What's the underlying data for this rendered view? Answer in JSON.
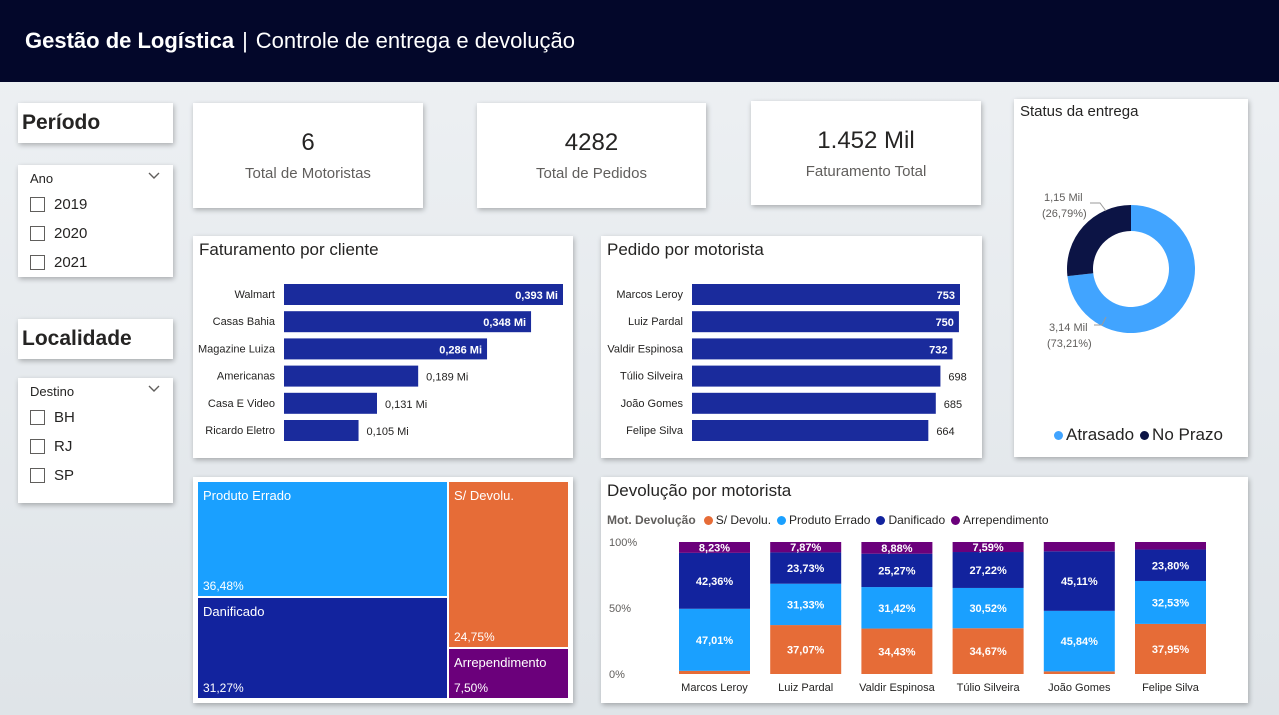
{
  "header": {
    "title_bold": "Gestão de Logística",
    "separator": "|",
    "title_rest": "Controle de entrega e devolução"
  },
  "filters": {
    "periodo": {
      "title": "Período",
      "field": "Ano",
      "options": [
        "2019",
        "2020",
        "2021"
      ]
    },
    "localidade": {
      "title": "Localidade",
      "field": "Destino",
      "options": [
        "BH",
        "RJ",
        "SP"
      ]
    }
  },
  "kpis": [
    {
      "value": "6",
      "label": "Total de Motoristas"
    },
    {
      "value": "4282",
      "label": "Total de Pedidos"
    },
    {
      "value": "1.452 Mil",
      "label": "Faturamento Total"
    }
  ],
  "colors": {
    "navy_bar": "#1a2b9c",
    "light_blue": "#1aa0ff",
    "dark_blue": "#12239e",
    "orange": "#e66c37",
    "purple": "#6b007b",
    "donut_light": "#41a4ff",
    "donut_dark": "#0c1445",
    "header": "#03072a"
  },
  "chart_data": [
    {
      "id": "faturamento",
      "type": "bar",
      "orientation": "horizontal",
      "title": "Faturamento por cliente",
      "categories": [
        "Walmart",
        "Casas Bahia",
        "Magazine Luiza",
        "Americanas",
        "Casa E Video",
        "Ricardo Eletro"
      ],
      "values": [
        0.393,
        0.348,
        0.286,
        0.189,
        0.131,
        0.105
      ],
      "labels": [
        "0,393 Mi",
        "0,348 Mi",
        "0,286 Mi",
        "0,189 Mi",
        "0,131 Mi",
        "0,105 Mi"
      ],
      "unit": "Mi"
    },
    {
      "id": "pedidos",
      "type": "bar",
      "orientation": "horizontal",
      "title": "Pedido por motorista",
      "categories": [
        "Marcos Leroy",
        "Luiz Pardal",
        "Valdir Espinosa",
        "Túlio Silveira",
        "João Gomes",
        "Felipe Silva"
      ],
      "values": [
        753,
        750,
        732,
        698,
        685,
        664
      ],
      "labels": [
        "753",
        "750",
        "732",
        "698",
        "685",
        "664"
      ]
    },
    {
      "id": "status",
      "type": "pie",
      "donut": true,
      "title": "Status da entrega",
      "series": [
        {
          "name": "Atrasado",
          "value": 3.14,
          "label": "3,14 Mil",
          "pct": "(73,21%)",
          "share": 73.21
        },
        {
          "name": "No Prazo",
          "value": 1.15,
          "label": "1,15 Mil",
          "pct": "(26,79%)",
          "share": 26.79
        }
      ],
      "legend_position": "bottom"
    },
    {
      "id": "treemap",
      "type": "treemap",
      "items": [
        {
          "name": "Produto Errado",
          "value": "36,48%",
          "share": 36.48
        },
        {
          "name": "Danificado",
          "value": "31,27%",
          "share": 31.27
        },
        {
          "name": "S/ Devolu.",
          "value": "24,75%",
          "share": 24.75
        },
        {
          "name": "Arrependimento",
          "value": "7,50%",
          "share": 7.5
        }
      ]
    },
    {
      "id": "devolucao",
      "type": "bar",
      "stacked": "100%",
      "title": "Devolução por motorista",
      "legend_title": "Mot. Devolução",
      "categories": [
        "Marcos Leroy",
        "Luiz Pardal",
        "Valdir Espinosa",
        "Túlio Silveira",
        "João Gomes",
        "Felipe Silva"
      ],
      "series": [
        {
          "name": "S/ Devolu.",
          "values": [
            2.4,
            37.07,
            34.43,
            34.67,
            2.0,
            37.95
          ],
          "labels": [
            "",
            "37,07%",
            "34,43%",
            "34,67%",
            "",
            "37,95%"
          ]
        },
        {
          "name": "Produto Errado",
          "values": [
            47.01,
            31.33,
            31.42,
            30.52,
            45.84,
            32.53
          ],
          "labels": [
            "47,01%",
            "31,33%",
            "31,42%",
            "30,52%",
            "45,84%",
            "32,53%"
          ]
        },
        {
          "name": "Danificado",
          "values": [
            42.36,
            23.73,
            25.27,
            27.22,
            45.11,
            23.8
          ],
          "labels": [
            "42,36%",
            "23,73%",
            "25,27%",
            "27,22%",
            "45,11%",
            "23,80%"
          ]
        },
        {
          "name": "Arrependimento",
          "values": [
            8.23,
            7.87,
            8.88,
            7.59,
            7.05,
            5.72
          ],
          "labels": [
            "8,23%",
            "7,87%",
            "8,88%",
            "7,59%",
            "",
            ""
          ]
        }
      ],
      "y_ticks": [
        "100%",
        "50%",
        "0%"
      ],
      "ylim": [
        0,
        100
      ]
    }
  ]
}
